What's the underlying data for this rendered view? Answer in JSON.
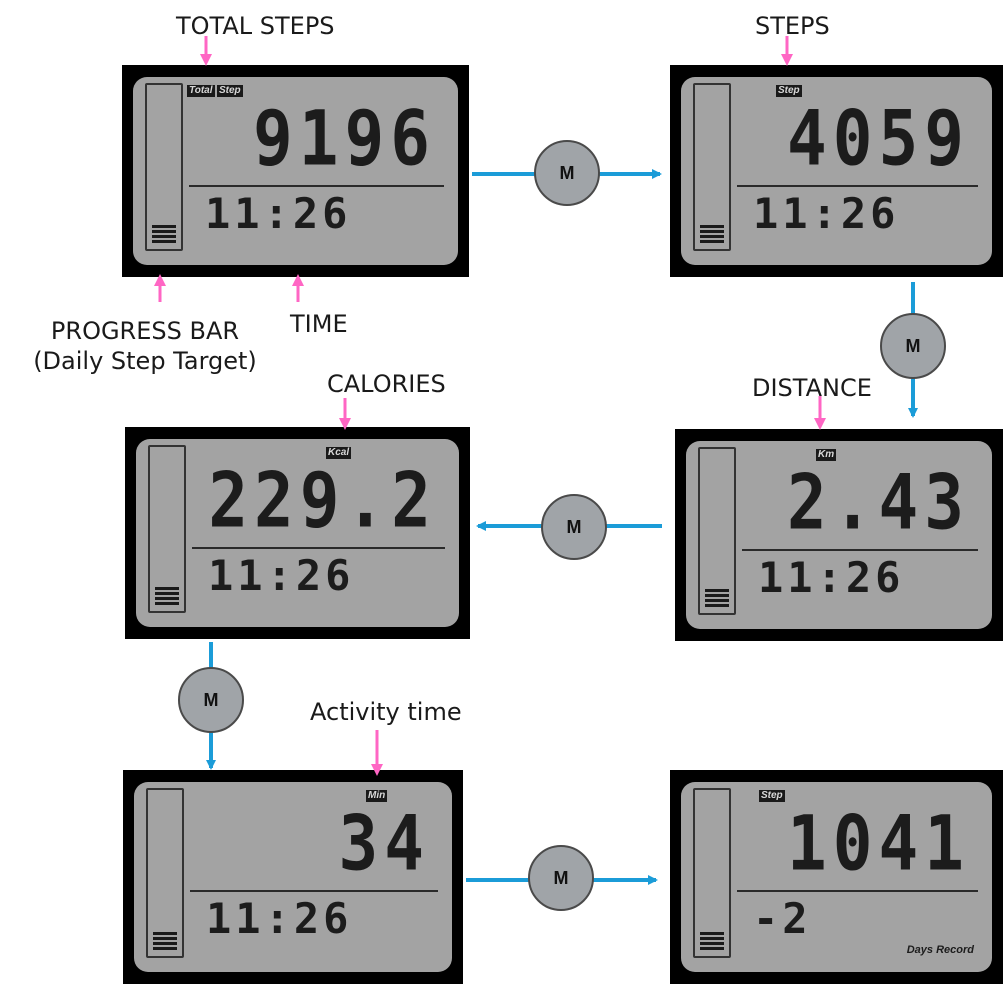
{
  "annotations": {
    "total_steps": "TOTAL STEPS",
    "steps": "STEPS",
    "progress_bar_line1": "PROGRESS BAR",
    "progress_bar_line2": "(Daily Step Target)",
    "time": "TIME",
    "calories": "CALORIES",
    "distance": "DISTANCE",
    "activity_time": "Activity time"
  },
  "button_label": "M",
  "screens": [
    {
      "id": "total-steps",
      "tags": [
        "Total",
        "Step"
      ],
      "value": "9196",
      "time": "11:26"
    },
    {
      "id": "steps",
      "tags": [
        "Step"
      ],
      "value": "4059",
      "time": "11:26"
    },
    {
      "id": "distance",
      "tags": [
        "Km"
      ],
      "value": "2.43",
      "time": "11:26"
    },
    {
      "id": "calories",
      "tags": [
        "Kcal"
      ],
      "value": "229.2",
      "time": "11:26"
    },
    {
      "id": "activity-time",
      "tags": [
        "Min"
      ],
      "value": "34",
      "time": "11:26"
    },
    {
      "id": "history",
      "tags": [
        "Step"
      ],
      "value": "1041",
      "time": "-2",
      "extra": "Days Record"
    }
  ],
  "colors": {
    "flow_arrow": "#1b9cd8",
    "pointer_arrow": "#ff66c4",
    "lcd_bg": "#a3a3a3",
    "bezel": "#000000"
  }
}
